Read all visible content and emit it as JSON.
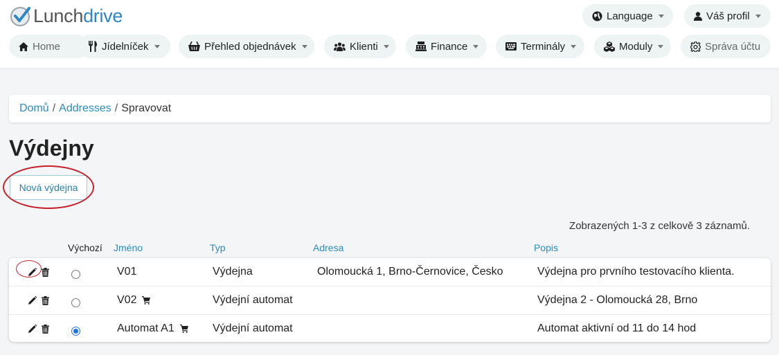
{
  "brand": {
    "name_part1": "Lunch",
    "name_part2": "drive"
  },
  "header": {
    "language_label": "Language",
    "profile_label": "Váš profil"
  },
  "nav": {
    "home": "Home",
    "menu": "Jídelníček",
    "orders": "Přehled objednávek",
    "clients": "Klienti",
    "finance": "Finance",
    "terminals": "Terminály",
    "modules": "Moduly",
    "account": "Správa účtu"
  },
  "breadcrumb": {
    "home": "Domů",
    "section": "Addresses",
    "current": "Spravovat"
  },
  "page": {
    "title": "Výdejny",
    "new_button": "Nová výdejna",
    "summary": "Zobrazených 1-3 z celkově 3 záznamů."
  },
  "table": {
    "headers": {
      "default": "Výchozí",
      "name": "Jméno",
      "type": "Typ",
      "address": "Adresa",
      "description": "Popis"
    },
    "rows": [
      {
        "name": "V01",
        "has_cart": false,
        "type": "Výdejna",
        "address": "Olomoucká 1, Brno-Černovice, Česko",
        "description": "Výdejna pro prvního testovacího klienta.",
        "default": false
      },
      {
        "name": "V02",
        "has_cart": true,
        "type": "Výdejní automat",
        "address": "",
        "description": "Výdejna 2 - Olomoucká 28, Brno",
        "default": false
      },
      {
        "name": "Automat A1",
        "has_cart": true,
        "type": "Výdejní automat",
        "address": "",
        "description": "Automat aktivní od 11 do 14 hod",
        "default": true
      }
    ]
  },
  "colors": {
    "brand_blue": "#2b87c5",
    "link": "#2a8bbd",
    "annotation_red": "#c8202a",
    "radio_checked": "#1a73e8"
  }
}
